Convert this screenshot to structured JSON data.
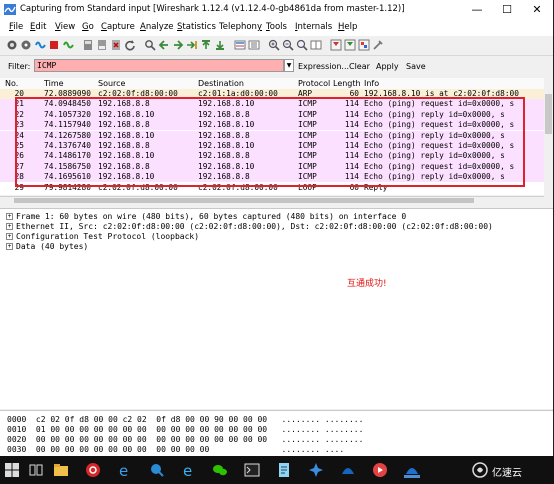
{
  "window": {
    "title": "Capturing from Standard input   [Wireshark 1.12.4  (v1.12.4-0-gb4861da from master-1.12)]",
    "controls": {
      "minimize": "—",
      "maximize": "☐",
      "close": "✕"
    }
  },
  "menu": [
    {
      "label": "File",
      "key": "F"
    },
    {
      "label": "Edit",
      "key": "E"
    },
    {
      "label": "View",
      "key": "V"
    },
    {
      "label": "Go",
      "key": "G"
    },
    {
      "label": "Capture",
      "key": "C"
    },
    {
      "label": "Analyze",
      "key": "A"
    },
    {
      "label": "Statistics",
      "key": "S"
    },
    {
      "label": "Telephony",
      "key": "y"
    },
    {
      "label": "Tools",
      "key": "T"
    },
    {
      "label": "Internals",
      "key": "I"
    },
    {
      "label": "Help",
      "key": "H"
    }
  ],
  "toolbar_icons": [
    "interface-list-icon",
    "capture-options-icon",
    "start-capture-icon",
    "stop-capture-icon",
    "restart-capture-icon",
    "open-file-icon",
    "save-file-icon",
    "close-file-icon",
    "reload-icon",
    "find-packet-icon",
    "go-back-icon",
    "go-forward-icon",
    "go-to-packet-icon",
    "go-first-icon",
    "go-last-icon",
    "colorize-icon",
    "auto-scroll-icon",
    "zoom-in-icon",
    "zoom-out-icon",
    "zoom-normal-icon",
    "resize-columns-icon",
    "capture-filters-icon",
    "display-filters-icon",
    "coloring-rules-icon",
    "preferences-icon"
  ],
  "filter": {
    "label": "Filter:",
    "value": "ICMP",
    "links": [
      "Expression...",
      "Clear",
      "Apply",
      "Save"
    ]
  },
  "columns": [
    "No.",
    "Time",
    "Source",
    "Destination",
    "Protocol",
    "Length",
    "Info"
  ],
  "packets": [
    {
      "no": "20",
      "time": "72.0889090",
      "src": "c2:02:0f:d8:00:00",
      "dst": "c2:01:1a:d0:00:00",
      "proto": "ARP",
      "len": "60",
      "info": "192.168.8.10 is at c2:02:0f:d8:00",
      "bg": "#faf0d7"
    },
    {
      "no": "21",
      "time": "74.0948450",
      "src": "192.168.8.8",
      "dst": "192.168.8.10",
      "proto": "ICMP",
      "len": "114",
      "info": "Echo (ping) request  id=0x0000, s",
      "bg": "#fce0ff"
    },
    {
      "no": "22",
      "time": "74.1057320",
      "src": "192.168.8.10",
      "dst": "192.168.8.8",
      "proto": "ICMP",
      "len": "114",
      "info": "Echo (ping) reply    id=0x0000, s",
      "bg": "#fce0ff"
    },
    {
      "no": "23",
      "time": "74.1157940",
      "src": "192.168.8.8",
      "dst": "192.168.8.10",
      "proto": "ICMP",
      "len": "114",
      "info": "Echo (ping) request  id=0x0000, s",
      "bg": "#fce0ff"
    },
    {
      "no": "24",
      "time": "74.1267580",
      "src": "192.168.8.10",
      "dst": "192.168.8.8",
      "proto": "ICMP",
      "len": "114",
      "info": "Echo (ping) reply    id=0x0000, s",
      "bg": "#fce0ff"
    },
    {
      "no": "25",
      "time": "74.1376740",
      "src": "192.168.8.8",
      "dst": "192.168.8.10",
      "proto": "ICMP",
      "len": "114",
      "info": "Echo (ping) request  id=0x0000, s",
      "bg": "#fce0ff"
    },
    {
      "no": "26",
      "time": "74.1486170",
      "src": "192.168.8.10",
      "dst": "192.168.8.8",
      "proto": "ICMP",
      "len": "114",
      "info": "Echo (ping) reply    id=0x0000, s",
      "bg": "#fce0ff"
    },
    {
      "no": "27",
      "time": "74.1586750",
      "src": "192.168.8.8",
      "dst": "192.168.8.10",
      "proto": "ICMP",
      "len": "114",
      "info": "Echo (ping) request  id=0x0000, s",
      "bg": "#fce0ff"
    },
    {
      "no": "28",
      "time": "74.1695610",
      "src": "192.168.8.10",
      "dst": "192.168.8.8",
      "proto": "ICMP",
      "len": "114",
      "info": "Echo (ping) reply    id=0x0000, s",
      "bg": "#fce0ff"
    },
    {
      "no": "29",
      "time": "79.9814280",
      "src": "c2:02:0f:d8:00:00",
      "dst": "c2:02:0f:d8:00:00",
      "proto": "LOOP",
      "len": "60",
      "info": "Reply",
      "bg": "#ffffff"
    }
  ],
  "details": [
    "Frame 1: 60 bytes on wire (480 bits), 60 bytes captured (480 bits) on interface 0",
    "Ethernet II, Src: c2:02:0f:d8:00:00 (c2:02:0f:d8:00:00), Dst: c2:02:0f:d8:00:00 (c2:02:0f:d8:00:00)",
    "Configuration Test Protocol (loopback)",
    "Data (40 bytes)"
  ],
  "annotation": "互通成功!",
  "hex": [
    "0000  c2 02 0f d8 00 00 c2 02  0f d8 00 00 90 00 00 00   ........ ........",
    "0010  01 00 00 00 00 00 00 00  00 00 00 00 00 00 00 00   ........ ........",
    "0020  00 00 00 00 00 00 00 00  00 00 00 00 00 00 00 00   ........ ........",
    "0030  00 00 00 00 00 00 00 00  00 00 00 00               ........ ...."
  ],
  "colors": {
    "filter_invalid_bg": "#ffafaf",
    "icmp_row_bg": "#fce0ff",
    "arp_row_bg": "#faf0d7",
    "highlight_box": "#e0202a",
    "annotation": "#e01010"
  },
  "taskbar": {
    "icons": [
      "start-button-icon",
      "task-view-icon",
      "file-explorer-icon",
      "netease-music-icon",
      "edge-browser-icon",
      "search-app-icon",
      "ie-browser-icon",
      "wechat-icon",
      "terminal-icon",
      "notepad-icon",
      "wing-app-icon",
      "wireshark-fin-icon",
      "media-app-icon",
      "wireshark-icon"
    ],
    "brand_logo": "亿速云"
  }
}
